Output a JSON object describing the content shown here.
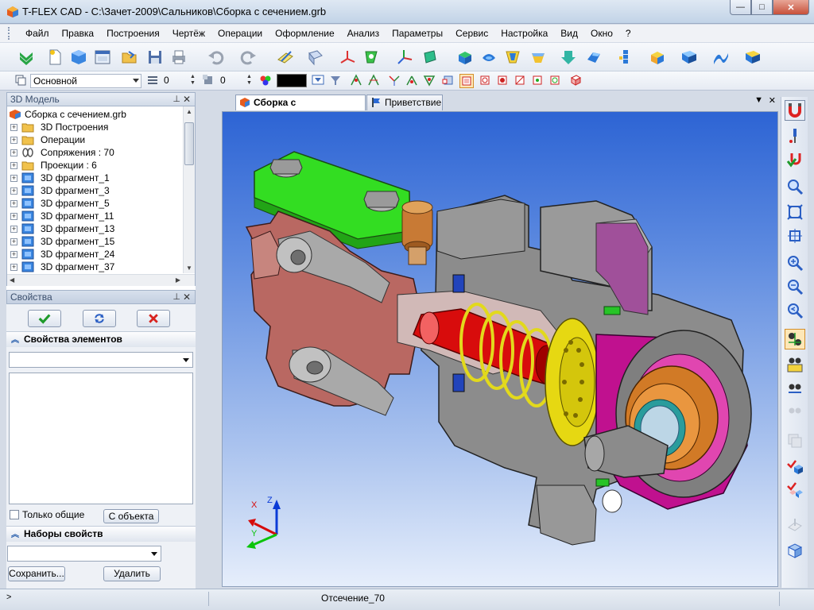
{
  "window": {
    "title": "T-FLEX CAD - C:\\Зачет-2009\\Сальников\\Сборка с сечением.grb",
    "buttons": {
      "minimize": "—",
      "maximize": "□",
      "close": "✕"
    }
  },
  "menu": [
    "Файл",
    "Правка",
    "Построения",
    "Чертёж",
    "Операции",
    "Оформление",
    "Анализ",
    "Параметры",
    "Сервис",
    "Настройка",
    "Вид",
    "Окно",
    "?"
  ],
  "toolbar2": {
    "layer": "Основной",
    "level": "0",
    "priority": "0",
    "color": "#000000"
  },
  "model_panel": {
    "title": "3D Модель",
    "items": [
      {
        "label": "Сборка с сечением.grb",
        "icon": "assembly-icon",
        "expander": ""
      },
      {
        "label": "3D Построения",
        "icon": "folder-icon",
        "expander": "+"
      },
      {
        "label": "Операции",
        "icon": "folder-icon",
        "expander": "+"
      },
      {
        "label": "Сопряжения : 70",
        "icon": "mates-icon",
        "expander": "+"
      },
      {
        "label": "Проекции : 6",
        "icon": "folder-icon",
        "expander": "+"
      },
      {
        "label": "3D фрагмент_1",
        "icon": "fragment-icon",
        "expander": "+"
      },
      {
        "label": "3D фрагмент_3",
        "icon": "fragment-icon",
        "expander": "+"
      },
      {
        "label": "3D фрагмент_5",
        "icon": "fragment-icon",
        "expander": "+"
      },
      {
        "label": "3D фрагмент_11",
        "icon": "fragment-icon",
        "expander": "+"
      },
      {
        "label": "3D фрагмент_13",
        "icon": "fragment-icon",
        "expander": "+"
      },
      {
        "label": "3D фрагмент_15",
        "icon": "fragment-icon",
        "expander": "+"
      },
      {
        "label": "3D фрагмент_24",
        "icon": "fragment-icon",
        "expander": "+"
      },
      {
        "label": "3D фрагмент_37",
        "icon": "fragment-icon",
        "expander": "+"
      }
    ]
  },
  "properties_panel": {
    "title": "Свойства",
    "element_props_header": "Свойства элементов",
    "only_common_label": "Только общие",
    "from_object_button": "С объекта",
    "property_sets_header": "Наборы свойств",
    "save_button": "Сохранить...",
    "delete_button": "Удалить"
  },
  "tabs": [
    {
      "label": "Сборка с сечением.grb",
      "active": true,
      "icon": "grb-file-icon"
    },
    {
      "label": "Приветствие",
      "active": false,
      "icon": "flag-icon"
    }
  ],
  "viewport": {
    "triad": {
      "x": "X",
      "y": "Y",
      "z": "Z"
    }
  },
  "status": {
    "prompt": ">",
    "text": "Отсечение_70"
  }
}
